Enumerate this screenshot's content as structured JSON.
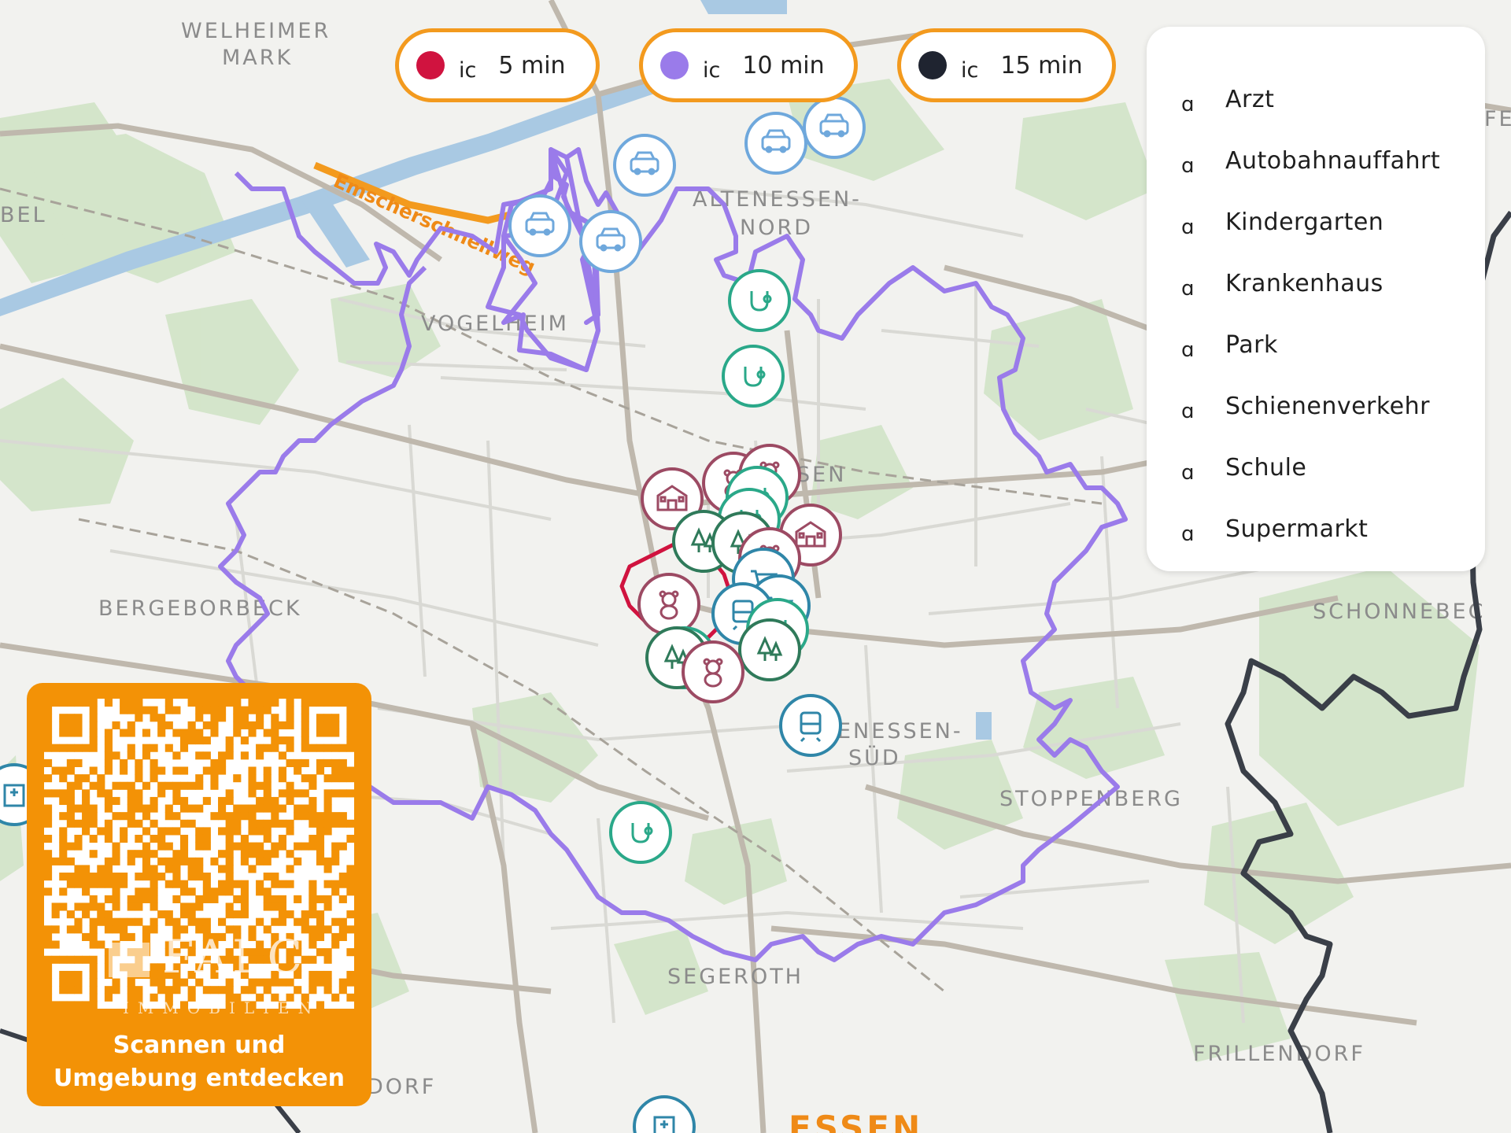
{
  "map": {
    "place_labels": [
      "WELHEIMER",
      "MARK",
      "BEL",
      "VOGELHEIM",
      "ALTENESSEN-",
      "NORD",
      "SEN",
      "BERGEBORBECK",
      "ENESSEN-",
      "SÜD",
      "STOPPENBERG",
      "SCHONNEBEC",
      "SEGEROTH",
      "FRILLENDORF",
      "DORF",
      "ESSEN",
      "FE"
    ],
    "river_label": "Emscherschnellweg"
  },
  "travel_time": [
    {
      "mode_icon": "ic",
      "time": "5 min",
      "color": "#d0133f"
    },
    {
      "mode_icon": "ic",
      "time": "10 min",
      "color": "#9a7bea"
    },
    {
      "mode_icon": "ic",
      "time": "15 min",
      "color": "#1f2430"
    }
  ],
  "legend": {
    "items": [
      {
        "icon": "ɑ",
        "label": "Arzt"
      },
      {
        "icon": "ɑ",
        "label": "Autobahnauffahrt"
      },
      {
        "icon": "ɑ",
        "label": "Kindergarten"
      },
      {
        "icon": "ɑ",
        "label": "Krankenhaus"
      },
      {
        "icon": "ɑ",
        "label": "Park"
      },
      {
        "icon": "ɑ",
        "label": "Schienenverkehr"
      },
      {
        "icon": "ɑ",
        "label": "Schule"
      },
      {
        "icon": "ɑ",
        "label": "Supermarkt"
      }
    ]
  },
  "qr": {
    "caption_line1": "Scannen und",
    "caption_line2": "Umgebung entdecken",
    "watermark": "FALC",
    "watermark_sub": "IMMOBILIEN"
  },
  "colors": {
    "accent": "#f39206",
    "isochrone_10": "#9a7bea",
    "isochrone_5": "#d0133f",
    "isochrone_15": "#3a3f48",
    "car_poi": "#6fa8dc",
    "doctor_poi": "#2aa889",
    "school_poi": "#9c4a63",
    "park_poi": "#2f7a5a",
    "rail_poi": "#2f86a8"
  }
}
